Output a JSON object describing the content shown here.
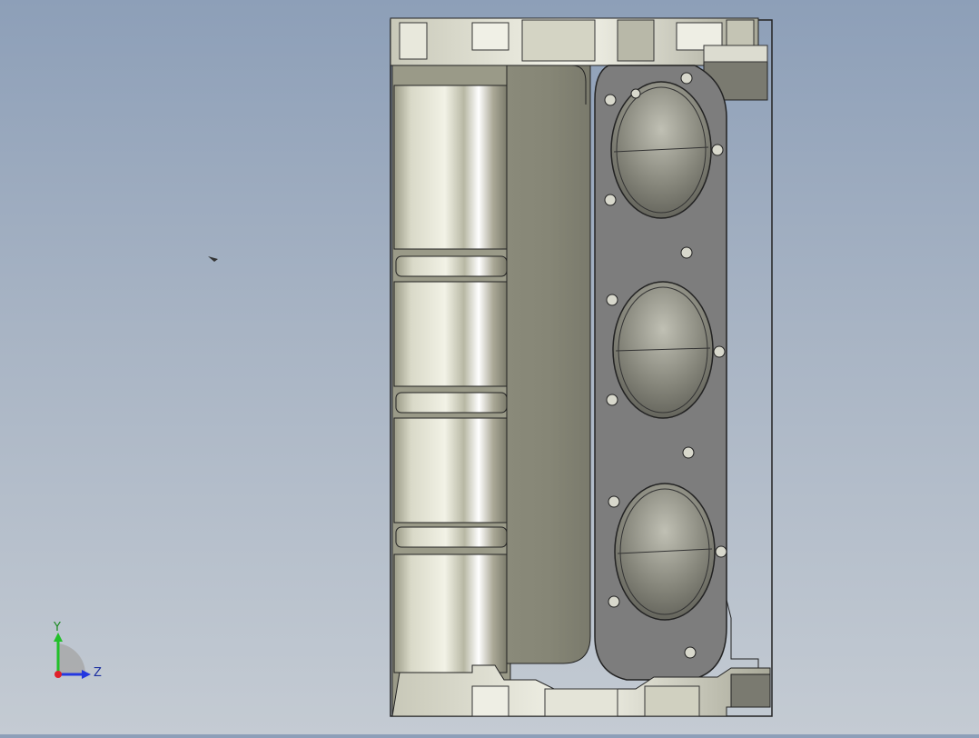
{
  "viewport": {
    "background_top": "#8d9fb8",
    "background_bottom": "#c4cbd3"
  },
  "model": {
    "cylinder_count": 3,
    "bolt_hole_count": 16,
    "body_color": "#8c8c7c",
    "deck_color": "#7d7d7d",
    "bore_color": "#6e6e66"
  },
  "triad": {
    "y_label": "Y",
    "z_label": "Z",
    "y_color": "#22c02a",
    "z_color": "#2438e0",
    "x_color": "#e0202a"
  }
}
